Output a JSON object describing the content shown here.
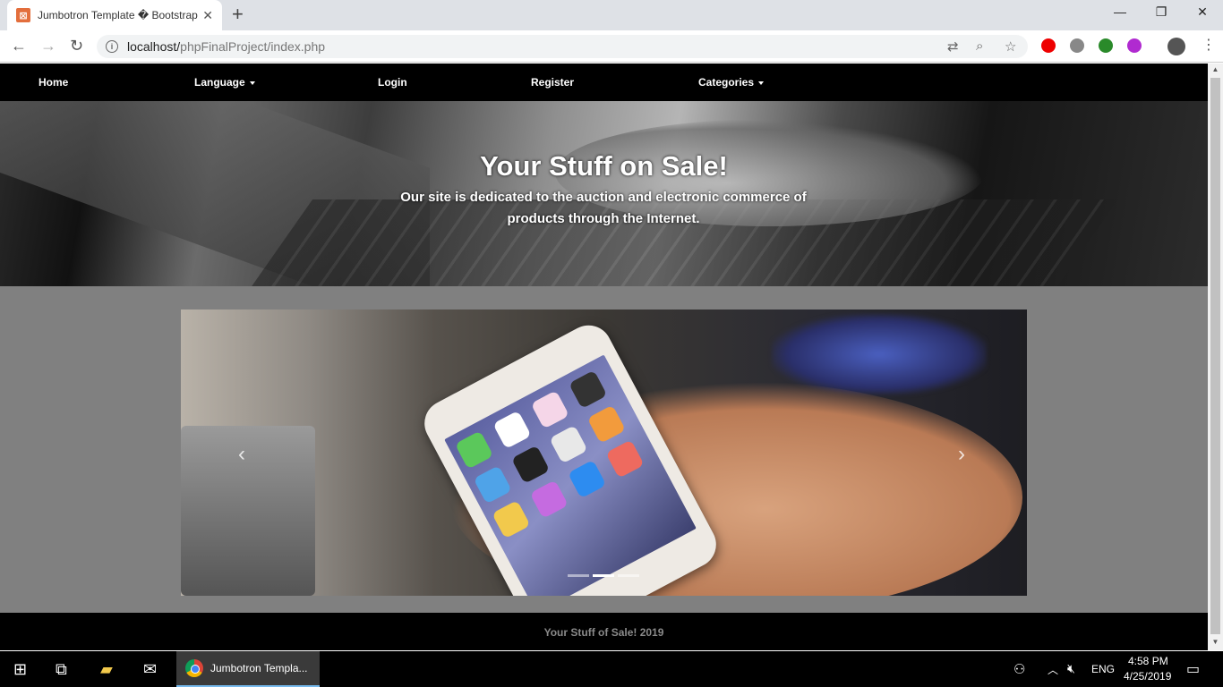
{
  "browser": {
    "tab_title": "Jumbotron Template � Bootstrap",
    "tab_favicon": "xampp-icon",
    "url_host": "localhost/",
    "url_path": "phpFinalProject/index.php",
    "new_tab": "+",
    "close_tab": "✕",
    "back": "←",
    "forward": "→",
    "reload": "↻",
    "minimize": "—",
    "restore": "❐",
    "close": "✕"
  },
  "navbar": {
    "home": "Home",
    "language": "Language",
    "login": "Login",
    "register": "Register",
    "categories": "Categories"
  },
  "jumbotron": {
    "title": "Your Stuff on Sale!",
    "subtitle": "Our site is dedicated to the auction and electronic commerce of products through the Internet."
  },
  "carousel": {
    "prev": "‹",
    "next": "›",
    "slides_count": 3,
    "active_slide": 2
  },
  "footer": {
    "text": "Your Stuff of Sale! 2019"
  },
  "taskbar": {
    "app_label": "Jumbotron Templa...",
    "language": "ENG",
    "time": "4:58 PM",
    "date": "4/25/2019"
  },
  "colors": {
    "navbar_bg": "#000000",
    "page_bg": "#808080",
    "footer_text": "#8a8a8a"
  }
}
